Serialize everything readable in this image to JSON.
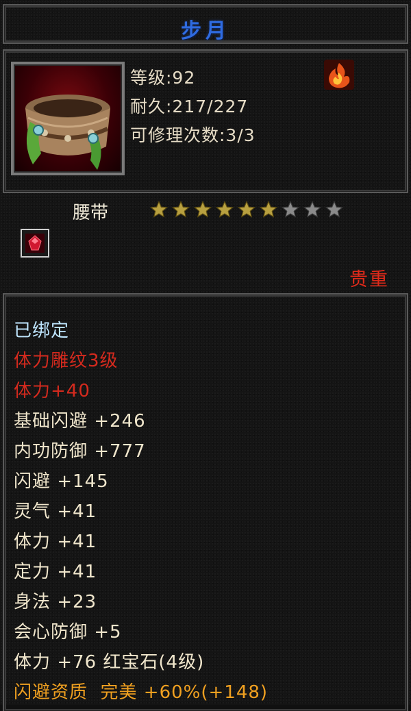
{
  "item": {
    "name": "步月",
    "level_line": "等级:92",
    "durability_line": "耐久:217/227",
    "repair_line": "可修理次数:3/3",
    "type": "腰带",
    "rarity": "贵重"
  },
  "stars": {
    "filled": 6,
    "total": 9
  },
  "colors": {
    "title": "#2f6be0",
    "bound": "#bfe6ff",
    "red_attr": "#d42a1e",
    "normal_attr": "#f0e6cc",
    "quality": "#f0a020",
    "star_gold": "#b8a040",
    "star_empty": "#8a8a8a"
  },
  "icons": {
    "item": "belt-item-icon",
    "element": "fire-element-icon",
    "gem_slot": "red-gem-slot-icon"
  },
  "attributes": [
    {
      "text": "已绑定",
      "style": "bound"
    },
    {
      "text": "体力雕纹3级",
      "style": "red"
    },
    {
      "text": "体力+40",
      "style": "red"
    },
    {
      "text": "基础闪避 +246",
      "style": "normal"
    },
    {
      "text": "内功防御 +777",
      "style": "normal"
    },
    {
      "text": "闪避 +145",
      "style": "normal"
    },
    {
      "text": "灵气 +41",
      "style": "normal"
    },
    {
      "text": "体力 +41",
      "style": "normal"
    },
    {
      "text": "定力 +41",
      "style": "normal"
    },
    {
      "text": "身法 +23",
      "style": "normal"
    },
    {
      "text": "会心防御 +5",
      "style": "normal"
    },
    {
      "text": "体力 +76 红宝石(4级)",
      "style": "normal"
    },
    {
      "text": "闪避资质  完美 +60%(+148)",
      "style": "orange"
    }
  ]
}
